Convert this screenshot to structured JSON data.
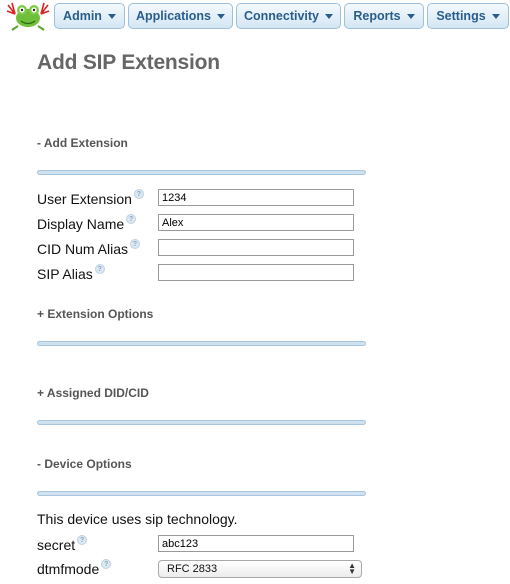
{
  "nav": {
    "items": [
      {
        "label": "Admin"
      },
      {
        "label": "Applications"
      },
      {
        "label": "Connectivity"
      },
      {
        "label": "Reports"
      },
      {
        "label": "Settings"
      }
    ]
  },
  "page": {
    "title": "Add SIP Extension"
  },
  "sections": {
    "add_extension": "- Add Extension",
    "extension_options": "+ Extension Options",
    "assigned_did": "+ Assigned DID/CID",
    "device_options": "- Device Options"
  },
  "fields": {
    "user_extension": {
      "label": "User Extension",
      "value": "1234"
    },
    "display_name": {
      "label": "Display Name",
      "value": "Alex"
    },
    "cid_num_alias": {
      "label": "CID Num Alias",
      "value": ""
    },
    "sip_alias": {
      "label": "SIP Alias",
      "value": ""
    },
    "secret": {
      "label": "secret",
      "value": "abc123"
    },
    "dtmfmode": {
      "label": "dtmfmode",
      "value": "RFC 2833"
    }
  },
  "device_text": "This device uses sip technology.",
  "colors": {
    "nav_text": "#2a5d8c",
    "title": "#666666",
    "section_bar": "#cfe0ef"
  }
}
